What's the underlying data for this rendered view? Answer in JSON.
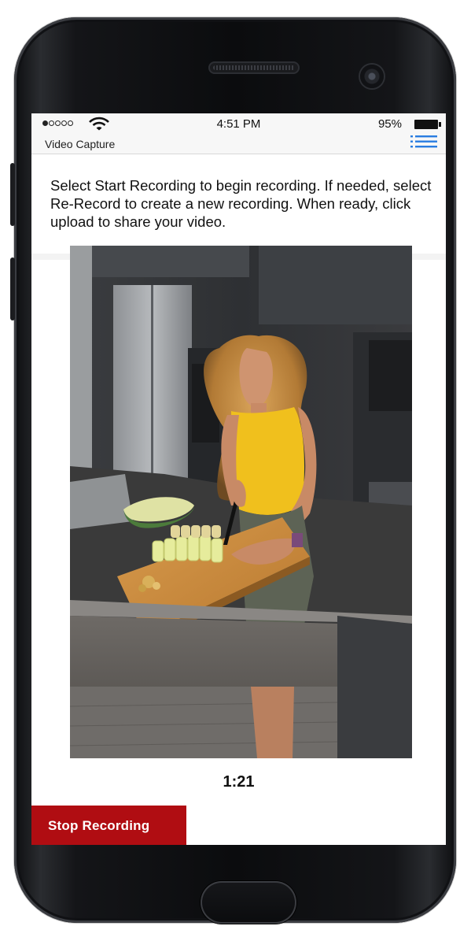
{
  "status_bar": {
    "time": "4:51 PM",
    "battery_percent": "95%",
    "signal_bars_filled": 1,
    "signal_bars_total": 5
  },
  "nav": {
    "title": "Video Capture",
    "menu_icon": "hamburger-menu-icon"
  },
  "instructions": "Select Start Recording to begin recording. If needed, select Re-Record to create a new recording. When ready, click upload to share your video.",
  "video": {
    "description_icon": "video-preview"
  },
  "timer": "1:21",
  "actions": {
    "stop_label": "Stop Recording"
  },
  "colors": {
    "accent_red": "#b00d12",
    "menu_blue": "#2a7de1",
    "bar_bg": "#f7f7f7"
  }
}
